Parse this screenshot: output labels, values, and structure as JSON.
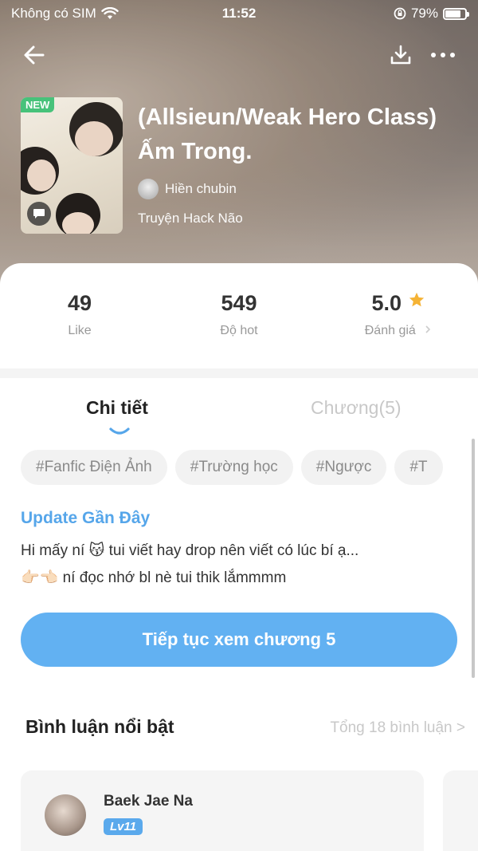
{
  "status_bar": {
    "carrier": "Không có SIM",
    "time": "11:52",
    "battery": "79%",
    "battery_level": 0.79
  },
  "header": {
    "icons": [
      "back-arrow-icon",
      "download-icon",
      "more-icon"
    ]
  },
  "book": {
    "badge": "NEW",
    "title": "(Allsieun/Weak Hero Class) Ấm Trong.",
    "author": "Hiền chubin",
    "category": "Truyện Hack Não"
  },
  "stats": [
    {
      "value": "49",
      "label": "Like"
    },
    {
      "value": "549",
      "label": "Độ hot"
    },
    {
      "value": "5.0",
      "label": "Đánh giá"
    }
  ],
  "tabs": {
    "detail": "Chi tiết",
    "chapters": "Chương(5)"
  },
  "tags": [
    "#Fanfic Điện Ảnh",
    "#Trường học",
    "#Ngược",
    "#T"
  ],
  "update": {
    "title": "Update Gần Đây",
    "line1": "Hi mấy ní 😽 tui viết hay drop nên viết có lúc bí ạ...",
    "line2": "👉🏻👈🏻 ní đọc nhớ bl nè tui thik lắmmmm"
  },
  "continue_button": "Tiếp tục xem chương 5",
  "comments": {
    "heading": "Bình luận nổi bật",
    "total": "Tổng 18 bình luận >",
    "items": [
      {
        "name": "Baek Jae Na",
        "level": "Lv11"
      }
    ]
  },
  "colors": {
    "accent": "#62b1f2",
    "update_title": "#56a6ea",
    "new_badge": "#47c27a",
    "star": "#f5b335"
  }
}
